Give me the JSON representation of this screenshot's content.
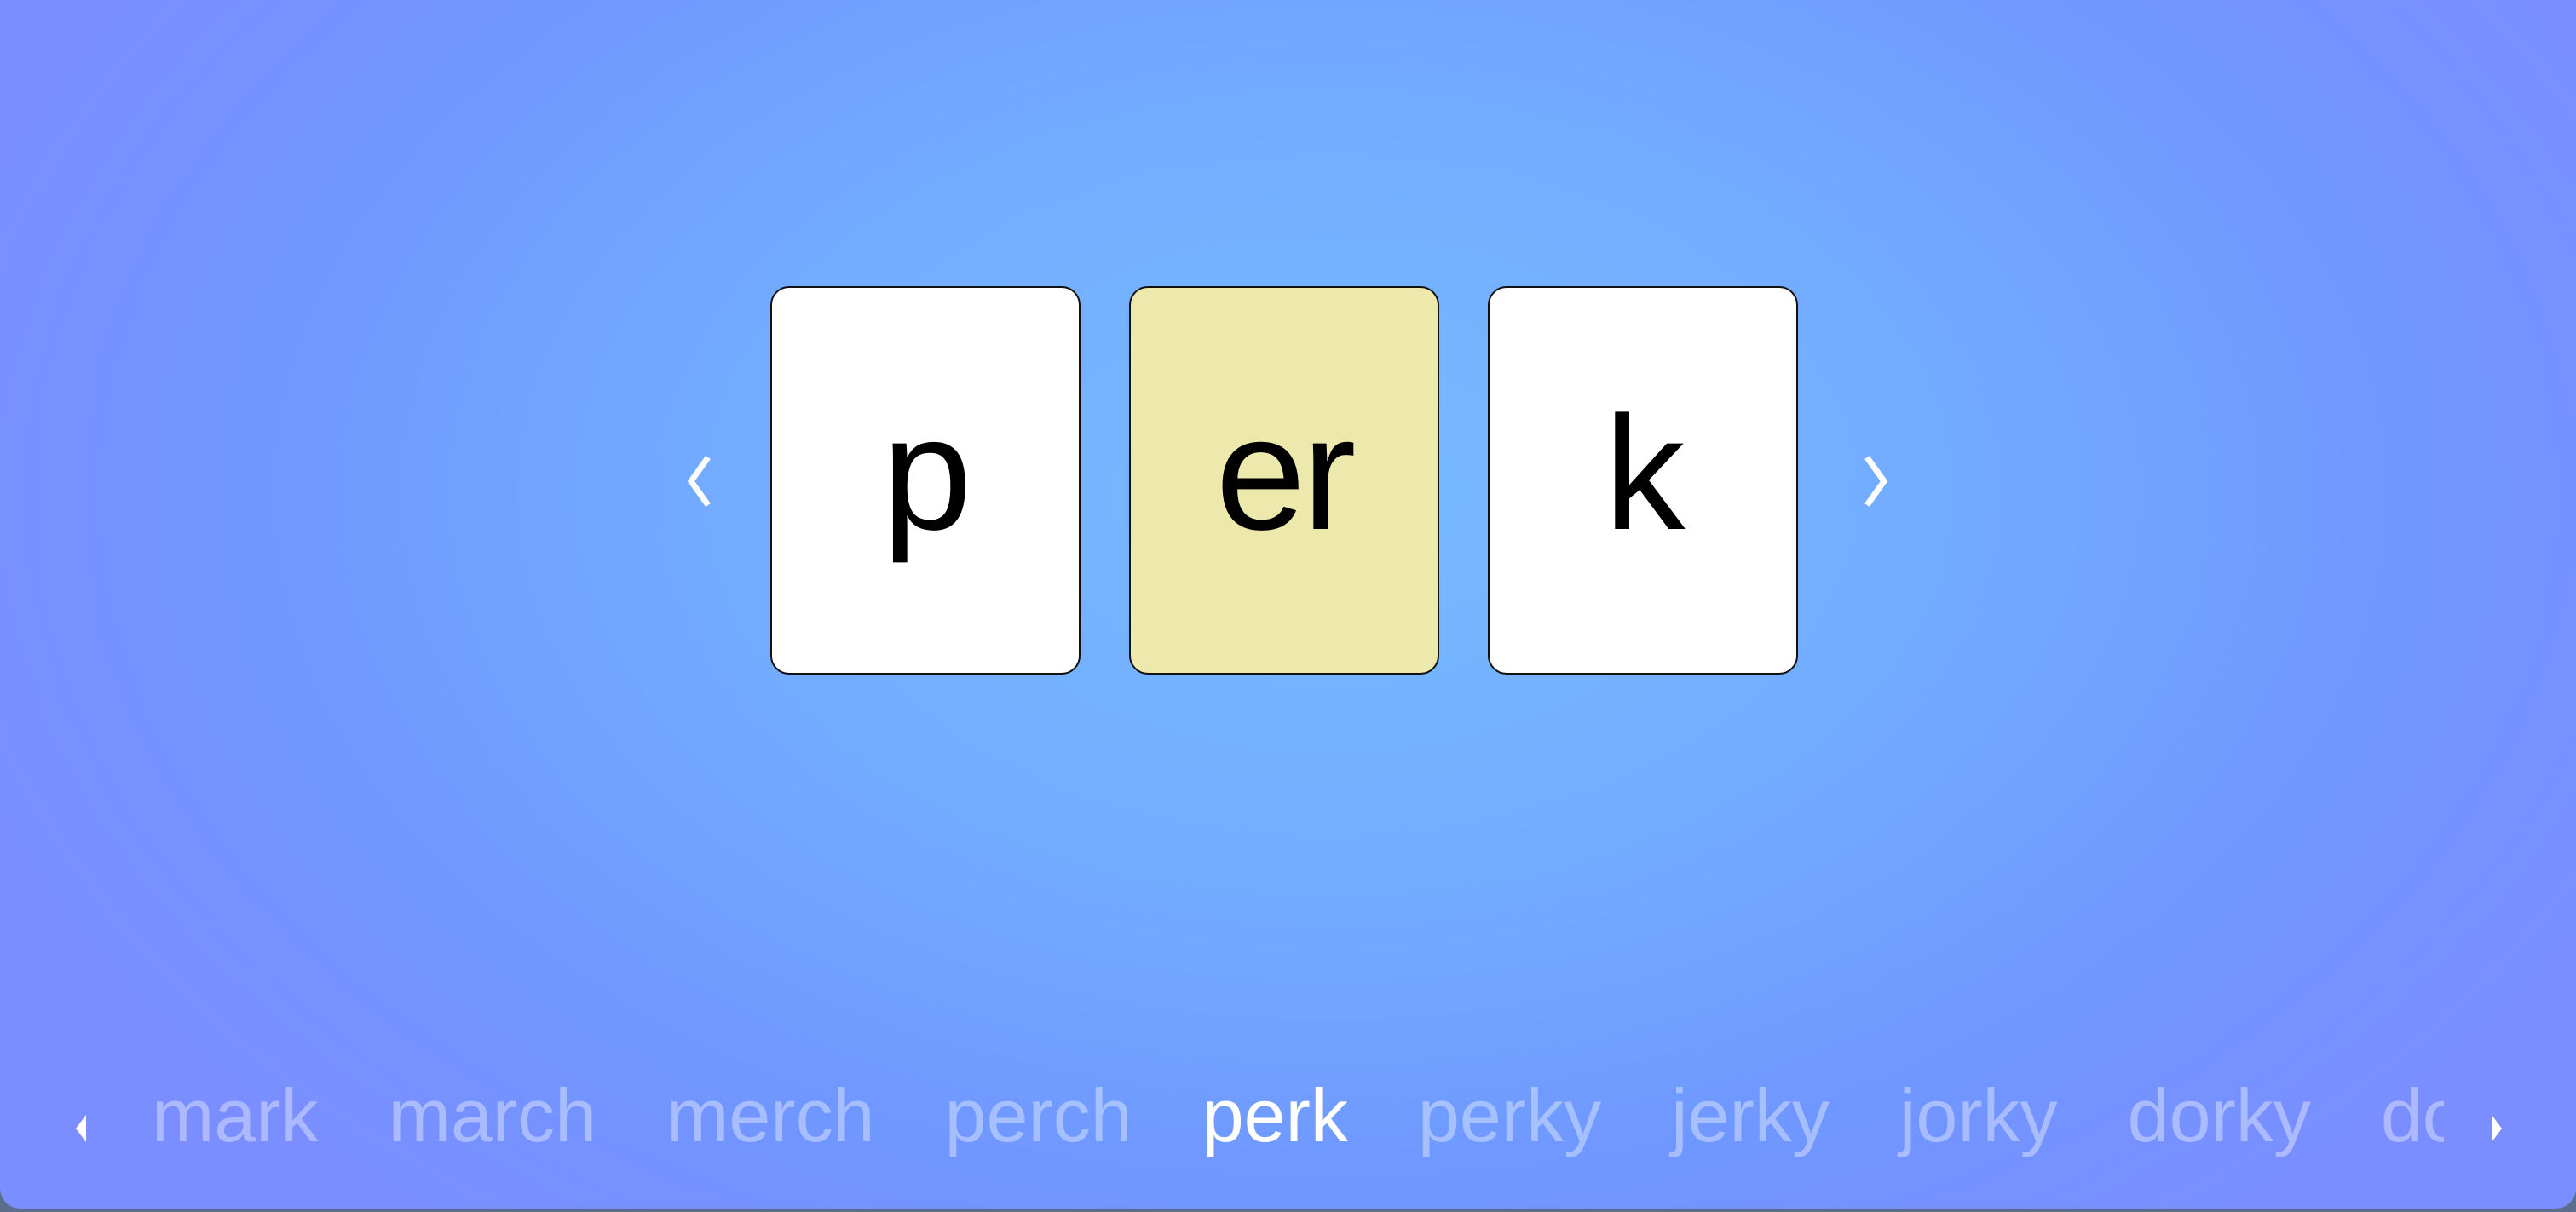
{
  "game": {
    "tiles": [
      {
        "text": "p",
        "highlighted": false
      },
      {
        "text": "er",
        "highlighted": true
      },
      {
        "text": "k",
        "highlighted": false
      }
    ],
    "prev_icon": "chevron-left-icon",
    "next_icon": "chevron-right-icon",
    "highlight_color": "#ede8ab"
  },
  "word_history": {
    "words": [
      "mark",
      "march",
      "merch",
      "perch",
      "perk",
      "perky",
      "jerky",
      "jorky",
      "dorky",
      "dork"
    ],
    "current_index": 4,
    "scroll_left_icon": "triangle-left-icon",
    "scroll_right_icon": "triangle-right-icon"
  }
}
